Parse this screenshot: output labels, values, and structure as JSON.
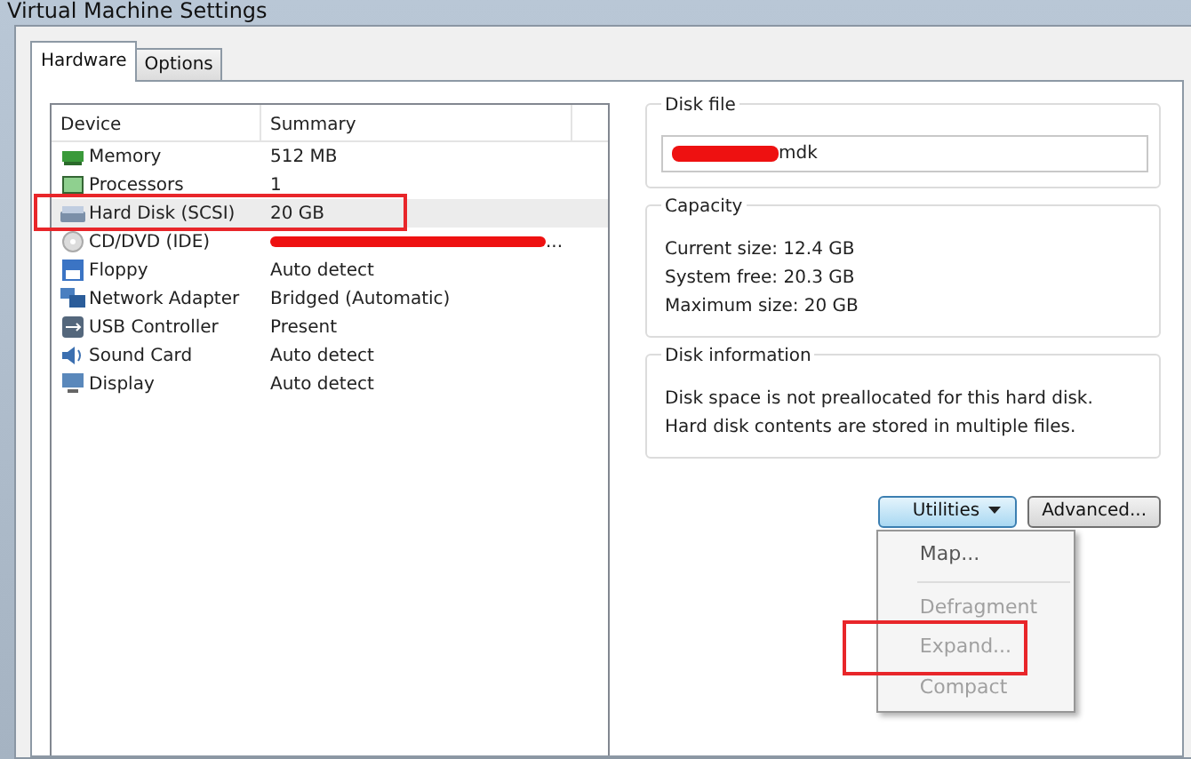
{
  "window": {
    "title": "Virtual Machine Settings"
  },
  "tabs": [
    {
      "label": "Hardware",
      "selected": true
    },
    {
      "label": "Options",
      "selected": false
    }
  ],
  "device_table": {
    "columns": [
      "Device",
      "Summary"
    ],
    "rows": [
      {
        "kind": "memory",
        "device": "Memory",
        "summary": "512 MB",
        "selected": false,
        "highlighted": false,
        "redacted": false
      },
      {
        "kind": "processor",
        "device": "Processors",
        "summary": "1",
        "selected": false,
        "highlighted": false,
        "redacted": false
      },
      {
        "kind": "disk",
        "device": "Hard Disk (SCSI)",
        "summary": "20 GB",
        "selected": true,
        "highlighted": true,
        "redacted": false
      },
      {
        "kind": "cd",
        "device": "CD/DVD (IDE)",
        "summary": "...",
        "selected": false,
        "highlighted": false,
        "redacted": true
      },
      {
        "kind": "floppy",
        "device": "Floppy",
        "summary": "Auto detect",
        "selected": false,
        "highlighted": false,
        "redacted": false
      },
      {
        "kind": "network",
        "device": "Network Adapter",
        "summary": "Bridged (Automatic)",
        "selected": false,
        "highlighted": false,
        "redacted": false
      },
      {
        "kind": "usb",
        "device": "USB Controller",
        "summary": "Present",
        "selected": false,
        "highlighted": false,
        "redacted": false
      },
      {
        "kind": "sound",
        "device": "Sound Card",
        "summary": "Auto detect",
        "selected": false,
        "highlighted": false,
        "redacted": false
      },
      {
        "kind": "display",
        "device": "Display",
        "summary": "Auto detect",
        "selected": false,
        "highlighted": false,
        "redacted": false
      }
    ]
  },
  "disk_file": {
    "title": "Disk file",
    "value": "mdk",
    "redacted": true
  },
  "capacity": {
    "title": "Capacity",
    "lines": [
      "Current size:  12.4 GB",
      "System free:  20.3 GB",
      "Maximum size:  20 GB"
    ]
  },
  "disk_information": {
    "title": "Disk information",
    "lines": [
      "Disk space is not preallocated for this hard disk.",
      "Hard disk contents are stored in multiple files."
    ]
  },
  "buttons": [
    {
      "label": "Utilities",
      "kind": "dropdown",
      "expanded": true
    },
    {
      "label": "Advanced...",
      "kind": "plain",
      "expanded": false
    }
  ],
  "utilities_menu": [
    {
      "label": "Map...",
      "kind": "item",
      "disabled": false,
      "highlighted": false
    },
    {
      "kind": "separator"
    },
    {
      "label": "Defragment",
      "kind": "item",
      "disabled": true,
      "highlighted": false
    },
    {
      "label": "Expand...",
      "kind": "item",
      "disabled": true,
      "highlighted": true
    },
    {
      "label": "Compact",
      "kind": "item",
      "disabled": true,
      "highlighted": false
    }
  ]
}
